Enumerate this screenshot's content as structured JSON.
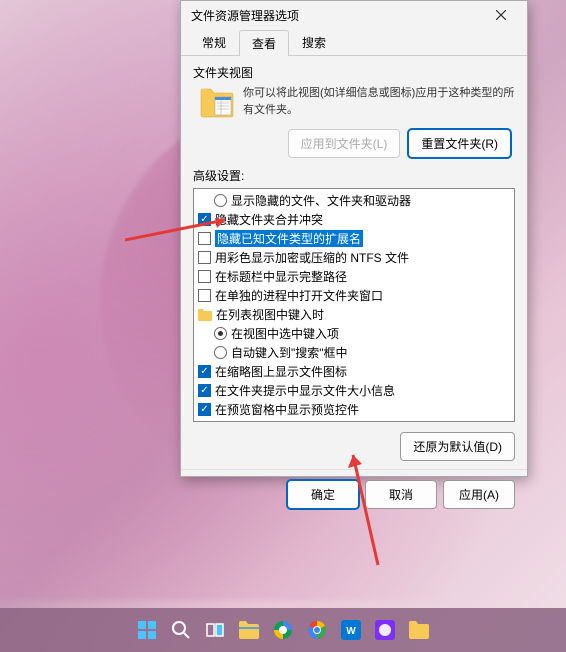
{
  "dialog": {
    "title": "文件资源管理器选项",
    "tabs": [
      "常规",
      "查看",
      "搜索"
    ],
    "active_tab": 1,
    "folder_views": {
      "label": "文件夹视图",
      "description": "你可以将此视图(如详细信息或图标)应用于这种类型的所有文件夹。",
      "apply_button": "应用到文件夹(L)",
      "reset_button": "重置文件夹(R)"
    },
    "advanced": {
      "label": "高级设置:",
      "items": [
        {
          "type": "radio",
          "checked": false,
          "indent": 1,
          "label": "显示隐藏的文件、文件夹和驱动器"
        },
        {
          "type": "check",
          "checked": true,
          "indent": 0,
          "label": "隐藏文件夹合并冲突"
        },
        {
          "type": "check",
          "checked": false,
          "indent": 0,
          "label": "隐藏已知文件类型的扩展名",
          "highlight": true
        },
        {
          "type": "check",
          "checked": false,
          "indent": 0,
          "label": "用彩色显示加密或压缩的 NTFS 文件"
        },
        {
          "type": "check",
          "checked": false,
          "indent": 0,
          "label": "在标题栏中显示完整路径"
        },
        {
          "type": "check",
          "checked": false,
          "indent": 0,
          "label": "在单独的进程中打开文件夹窗口"
        },
        {
          "type": "folder",
          "indent": 0,
          "label": "在列表视图中键入时"
        },
        {
          "type": "radio",
          "checked": true,
          "indent": 1,
          "label": "在视图中选中键入项"
        },
        {
          "type": "radio",
          "checked": false,
          "indent": 1,
          "label": "自动键入到\"搜索\"框中"
        },
        {
          "type": "check",
          "checked": true,
          "indent": 0,
          "label": "在缩略图上显示文件图标"
        },
        {
          "type": "check",
          "checked": true,
          "indent": 0,
          "label": "在文件夹提示中显示文件大小信息"
        },
        {
          "type": "check",
          "checked": true,
          "indent": 0,
          "label": "在预览窗格中显示预览控件"
        }
      ],
      "restore_button": "还原为默认值(D)"
    },
    "buttons": {
      "ok": "确定",
      "cancel": "取消",
      "apply": "应用(A)"
    }
  }
}
